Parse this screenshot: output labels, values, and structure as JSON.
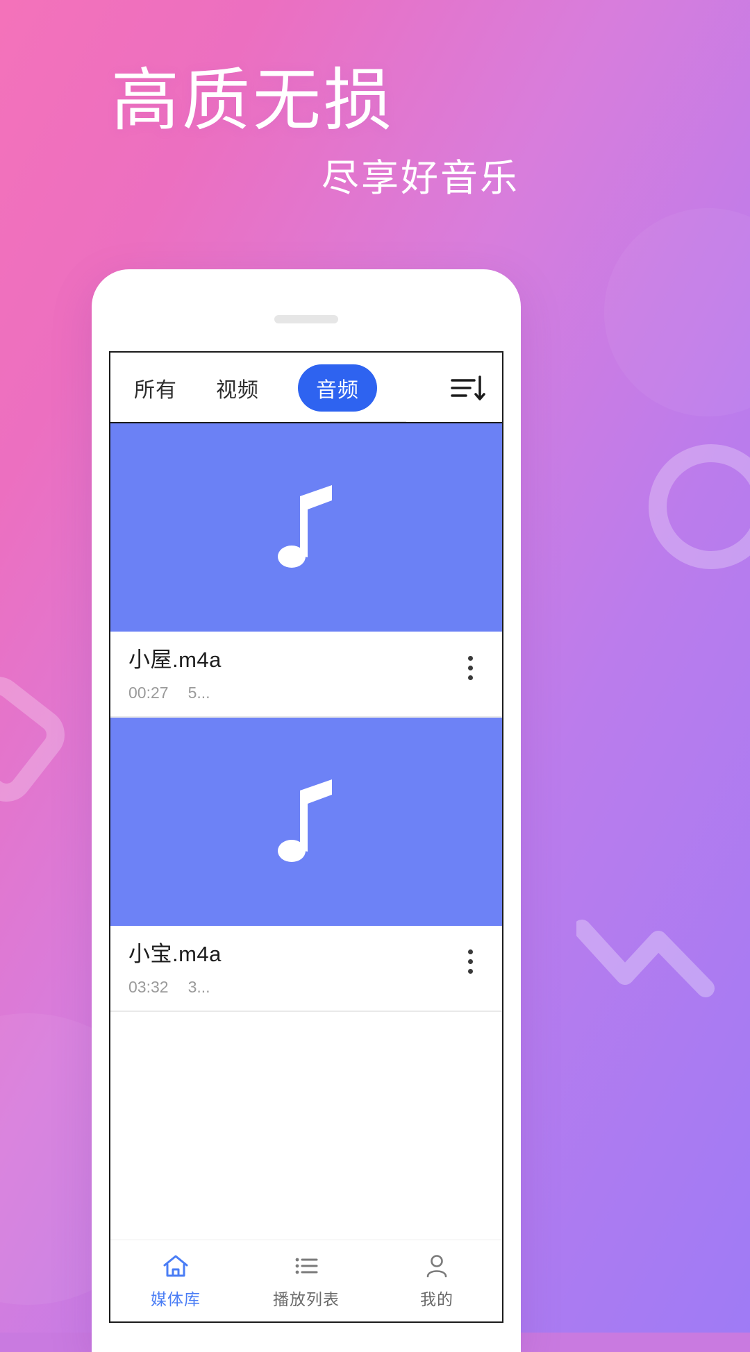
{
  "promo": {
    "headline": "高质无损",
    "subhead": "尽享好音乐"
  },
  "colors": {
    "bg_start": "#f472ba",
    "bg_end": "#9f7bf5",
    "accent_blue": "#2e63f0",
    "thumb_blue": "#6b81f5",
    "nav_active": "#4a7df5"
  },
  "app": {
    "tabs": [
      {
        "label": "所有",
        "active": false,
        "name": "tab-all"
      },
      {
        "label": "视频",
        "active": false,
        "name": "tab-video"
      },
      {
        "label": "音频",
        "active": true,
        "name": "tab-audio"
      }
    ],
    "sort_icon": "sort-list-icon",
    "items": [
      {
        "name": "小屋.m4a",
        "duration": "00:27",
        "size": "5...",
        "thumb_icon": "music-note-icon",
        "menu_icon": "kebab-menu-icon"
      },
      {
        "name": "小宝.m4a",
        "duration": "03:32",
        "size": "3...",
        "thumb_icon": "music-note-icon",
        "menu_icon": "kebab-menu-icon"
      }
    ],
    "bottom_nav": [
      {
        "label": "媒体库",
        "icon": "home-icon",
        "active": true
      },
      {
        "label": "播放列表",
        "icon": "list-icon",
        "active": false
      },
      {
        "label": "我的",
        "icon": "person-icon",
        "active": false
      }
    ]
  }
}
